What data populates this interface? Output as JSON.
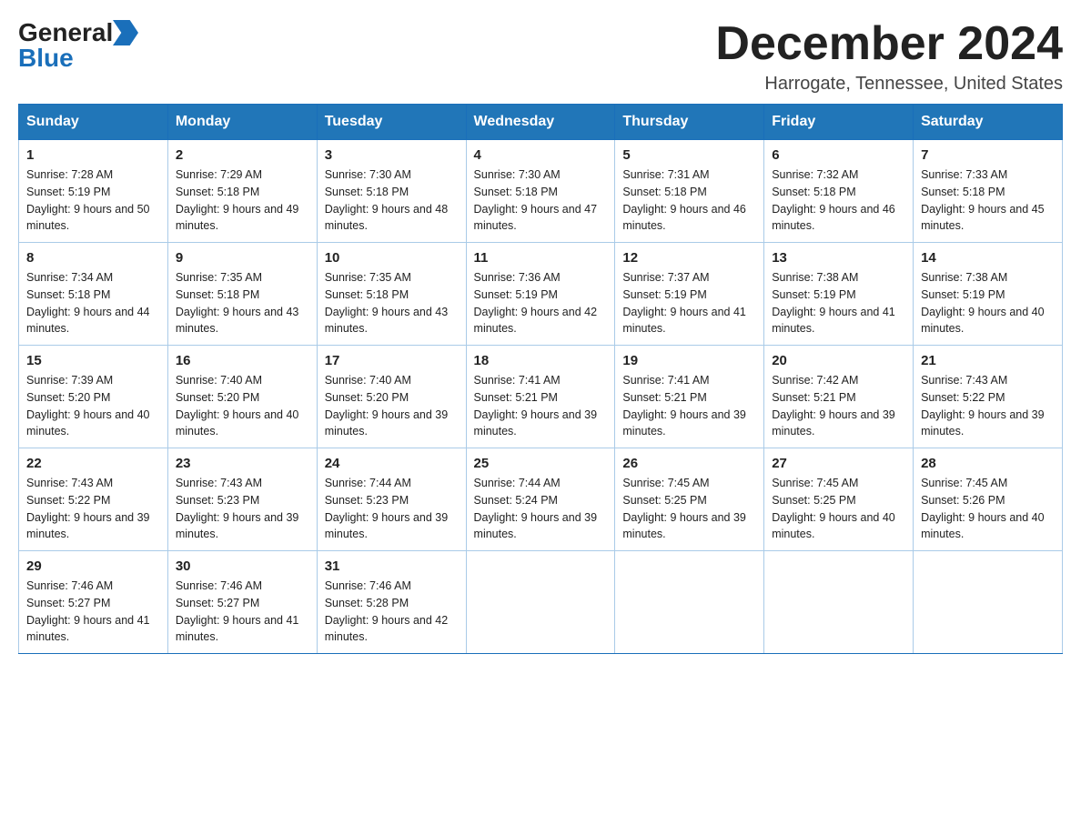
{
  "logo": {
    "general": "General",
    "blue": "Blue",
    "arrow_color": "#1a6fba"
  },
  "header": {
    "month_title": "December 2024",
    "location": "Harrogate, Tennessee, United States"
  },
  "weekdays": [
    "Sunday",
    "Monday",
    "Tuesday",
    "Wednesday",
    "Thursday",
    "Friday",
    "Saturday"
  ],
  "weeks": [
    [
      {
        "day": "1",
        "sunrise": "7:28 AM",
        "sunset": "5:19 PM",
        "daylight": "9 hours and 50 minutes."
      },
      {
        "day": "2",
        "sunrise": "7:29 AM",
        "sunset": "5:18 PM",
        "daylight": "9 hours and 49 minutes."
      },
      {
        "day": "3",
        "sunrise": "7:30 AM",
        "sunset": "5:18 PM",
        "daylight": "9 hours and 48 minutes."
      },
      {
        "day": "4",
        "sunrise": "7:30 AM",
        "sunset": "5:18 PM",
        "daylight": "9 hours and 47 minutes."
      },
      {
        "day": "5",
        "sunrise": "7:31 AM",
        "sunset": "5:18 PM",
        "daylight": "9 hours and 46 minutes."
      },
      {
        "day": "6",
        "sunrise": "7:32 AM",
        "sunset": "5:18 PM",
        "daylight": "9 hours and 46 minutes."
      },
      {
        "day": "7",
        "sunrise": "7:33 AM",
        "sunset": "5:18 PM",
        "daylight": "9 hours and 45 minutes."
      }
    ],
    [
      {
        "day": "8",
        "sunrise": "7:34 AM",
        "sunset": "5:18 PM",
        "daylight": "9 hours and 44 minutes."
      },
      {
        "day": "9",
        "sunrise": "7:35 AM",
        "sunset": "5:18 PM",
        "daylight": "9 hours and 43 minutes."
      },
      {
        "day": "10",
        "sunrise": "7:35 AM",
        "sunset": "5:18 PM",
        "daylight": "9 hours and 43 minutes."
      },
      {
        "day": "11",
        "sunrise": "7:36 AM",
        "sunset": "5:19 PM",
        "daylight": "9 hours and 42 minutes."
      },
      {
        "day": "12",
        "sunrise": "7:37 AM",
        "sunset": "5:19 PM",
        "daylight": "9 hours and 41 minutes."
      },
      {
        "day": "13",
        "sunrise": "7:38 AM",
        "sunset": "5:19 PM",
        "daylight": "9 hours and 41 minutes."
      },
      {
        "day": "14",
        "sunrise": "7:38 AM",
        "sunset": "5:19 PM",
        "daylight": "9 hours and 40 minutes."
      }
    ],
    [
      {
        "day": "15",
        "sunrise": "7:39 AM",
        "sunset": "5:20 PM",
        "daylight": "9 hours and 40 minutes."
      },
      {
        "day": "16",
        "sunrise": "7:40 AM",
        "sunset": "5:20 PM",
        "daylight": "9 hours and 40 minutes."
      },
      {
        "day": "17",
        "sunrise": "7:40 AM",
        "sunset": "5:20 PM",
        "daylight": "9 hours and 39 minutes."
      },
      {
        "day": "18",
        "sunrise": "7:41 AM",
        "sunset": "5:21 PM",
        "daylight": "9 hours and 39 minutes."
      },
      {
        "day": "19",
        "sunrise": "7:41 AM",
        "sunset": "5:21 PM",
        "daylight": "9 hours and 39 minutes."
      },
      {
        "day": "20",
        "sunrise": "7:42 AM",
        "sunset": "5:21 PM",
        "daylight": "9 hours and 39 minutes."
      },
      {
        "day": "21",
        "sunrise": "7:43 AM",
        "sunset": "5:22 PM",
        "daylight": "9 hours and 39 minutes."
      }
    ],
    [
      {
        "day": "22",
        "sunrise": "7:43 AM",
        "sunset": "5:22 PM",
        "daylight": "9 hours and 39 minutes."
      },
      {
        "day": "23",
        "sunrise": "7:43 AM",
        "sunset": "5:23 PM",
        "daylight": "9 hours and 39 minutes."
      },
      {
        "day": "24",
        "sunrise": "7:44 AM",
        "sunset": "5:23 PM",
        "daylight": "9 hours and 39 minutes."
      },
      {
        "day": "25",
        "sunrise": "7:44 AM",
        "sunset": "5:24 PM",
        "daylight": "9 hours and 39 minutes."
      },
      {
        "day": "26",
        "sunrise": "7:45 AM",
        "sunset": "5:25 PM",
        "daylight": "9 hours and 39 minutes."
      },
      {
        "day": "27",
        "sunrise": "7:45 AM",
        "sunset": "5:25 PM",
        "daylight": "9 hours and 40 minutes."
      },
      {
        "day": "28",
        "sunrise": "7:45 AM",
        "sunset": "5:26 PM",
        "daylight": "9 hours and 40 minutes."
      }
    ],
    [
      {
        "day": "29",
        "sunrise": "7:46 AM",
        "sunset": "5:27 PM",
        "daylight": "9 hours and 41 minutes."
      },
      {
        "day": "30",
        "sunrise": "7:46 AM",
        "sunset": "5:27 PM",
        "daylight": "9 hours and 41 minutes."
      },
      {
        "day": "31",
        "sunrise": "7:46 AM",
        "sunset": "5:28 PM",
        "daylight": "9 hours and 42 minutes."
      },
      null,
      null,
      null,
      null
    ]
  ],
  "labels": {
    "sunrise_label": "Sunrise:",
    "sunset_label": "Sunset:",
    "daylight_label": "Daylight:"
  }
}
